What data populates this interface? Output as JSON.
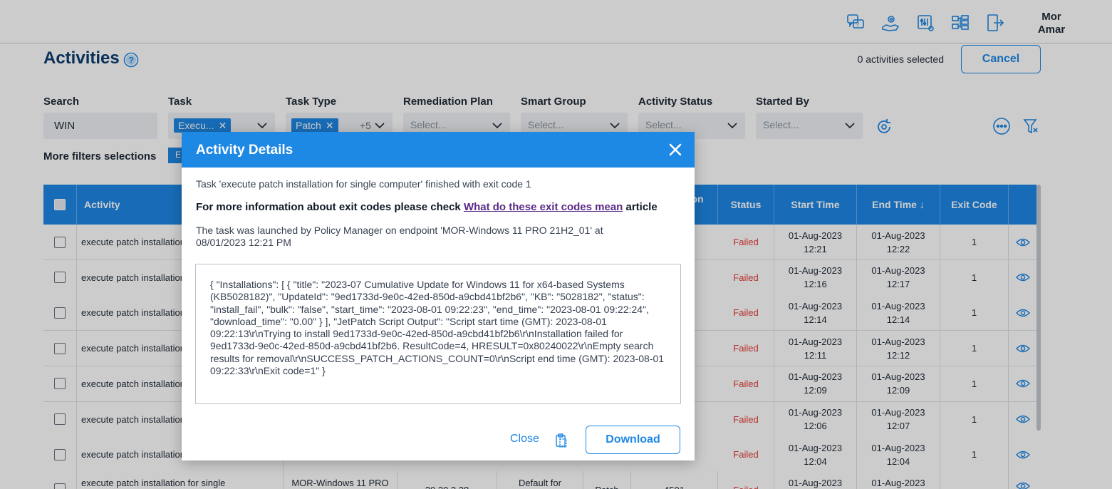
{
  "app": {
    "user": "Mor Amar",
    "top_icons": [
      "help-chat-icon",
      "hand-gear-icon",
      "settings-sliders-icon",
      "hierarchy-icon",
      "logout-icon"
    ],
    "colors": {
      "accent": "#1e88e5",
      "failed": "#e53935",
      "title": "#0c3c6e"
    }
  },
  "page": {
    "title": "Activities",
    "selected_text": "0 activities selected",
    "cancel_label": "Cancel"
  },
  "filters": {
    "search": {
      "label": "Search",
      "value": "WIN"
    },
    "task": {
      "label": "Task",
      "chip": "Execu..."
    },
    "task_type": {
      "label": "Task Type",
      "chip": "Patch",
      "more": "+5"
    },
    "remediation_plan": {
      "label": "Remediation Plan",
      "placeholder": "Select..."
    },
    "smart_group": {
      "label": "Smart Group",
      "placeholder": "Select..."
    },
    "activity_status": {
      "label": "Activity Status",
      "placeholder": "Select..."
    },
    "started_by": {
      "label": "Started By",
      "placeholder": "Select..."
    },
    "more_label": "More filters selections",
    "more_chip": "E"
  },
  "table": {
    "headers": {
      "activity": "Activity",
      "location": "on",
      "status": "Status",
      "start_time": "Start Time",
      "end_time": "End Time",
      "exit_code": "Exit Code"
    },
    "rows": [
      {
        "activity": "execute patch installation for single computer",
        "status": "Failed",
        "start_date": "01-Aug-2023",
        "start_time": "12:21",
        "end_date": "01-Aug-2023",
        "end_time": "12:22",
        "exit_code": "1"
      },
      {
        "activity": "execute patch installation for single computer",
        "status": "Failed",
        "start_date": "01-Aug-2023",
        "start_time": "12:16",
        "end_date": "01-Aug-2023",
        "end_time": "12:17",
        "exit_code": "1"
      },
      {
        "activity": "execute patch installation for single computer",
        "status": "Failed",
        "start_date": "01-Aug-2023",
        "start_time": "12:14",
        "end_date": "01-Aug-2023",
        "end_time": "12:14",
        "exit_code": "1"
      },
      {
        "activity": "execute patch installation for single computer",
        "status": "Failed",
        "start_date": "01-Aug-2023",
        "start_time": "12:11",
        "end_date": "01-Aug-2023",
        "end_time": "12:12",
        "exit_code": "1"
      },
      {
        "activity": "execute patch installation for single computer",
        "status": "Failed",
        "start_date": "01-Aug-2023",
        "start_time": "12:09",
        "end_date": "01-Aug-2023",
        "end_time": "12:09",
        "exit_code": "1"
      },
      {
        "activity": "execute patch installation for single computer",
        "status": "Failed",
        "start_date": "01-Aug-2023",
        "start_time": "12:06",
        "end_date": "01-Aug-2023",
        "end_time": "12:07",
        "exit_code": "1"
      },
      {
        "activity": "execute patch installation for single computer",
        "status": "Failed",
        "start_date": "01-Aug-2023",
        "start_time": "12:04",
        "end_date": "01-Aug-2023",
        "end_time": "12:04",
        "exit_code": "1"
      }
    ],
    "last_row": {
      "activity": "execute patch installation for single",
      "endpoint": "MOR-Windows 11 PRO",
      "ip": "30.30.3.28",
      "plan": "Default for",
      "type": "Patch",
      "id": "4501",
      "status": "Failed",
      "start_date": "01-Aug-2023",
      "end_date": "01-Aug-2023"
    }
  },
  "modal": {
    "title": "Activity Details",
    "line1": "Task 'execute patch installation for single computer' finished with exit code 1",
    "line2_prefix": "For more information about exit codes please check ",
    "line2_link": "What do these exit codes mean",
    "line2_suffix": " article",
    "line3": "The task was launched by Policy Manager on endpoint 'MOR-Windows 11 PRO 21H2_01' at 08/01/2023 12:21 PM",
    "output": "{ \"Installations\": [ { \"title\": \"2023-07 Cumulative Update for Windows 11 for x64-based Systems (KB5028182)\", \"UpdateId\": \"9ed1733d-9e0c-42ed-850d-a9cbd41bf2b6\", \"KB\": \"5028182\", \"status\": \"install_fail\", \"bulk\": \"false\", \"start_time\": \"2023-08-01 09:22:23\", \"end_time\": \"2023-08-01 09:22:24\", \"download_time\": \"0.00\" } ], \"JetPatch Script Output\": \"Script start time (GMT): 2023-08-01 09:22:13\\r\\nTrying to install 9ed1733d-9e0c-42ed-850d-a9cbd41bf2b6\\r\\nInstallation failed for 9ed1733d-9e0c-42ed-850d-a9cbd41bf2b6. ResultCode=4, HRESULT=0x80240022\\r\\nEmpty search results for removal\\r\\nSUCCESS_PATCH_ACTIONS_COUNT=0\\r\\nScript end time (GMT): 2023-08-01 09:22:33\\r\\nExit code=1\" }",
    "close_label": "Close",
    "download_label": "Download"
  }
}
